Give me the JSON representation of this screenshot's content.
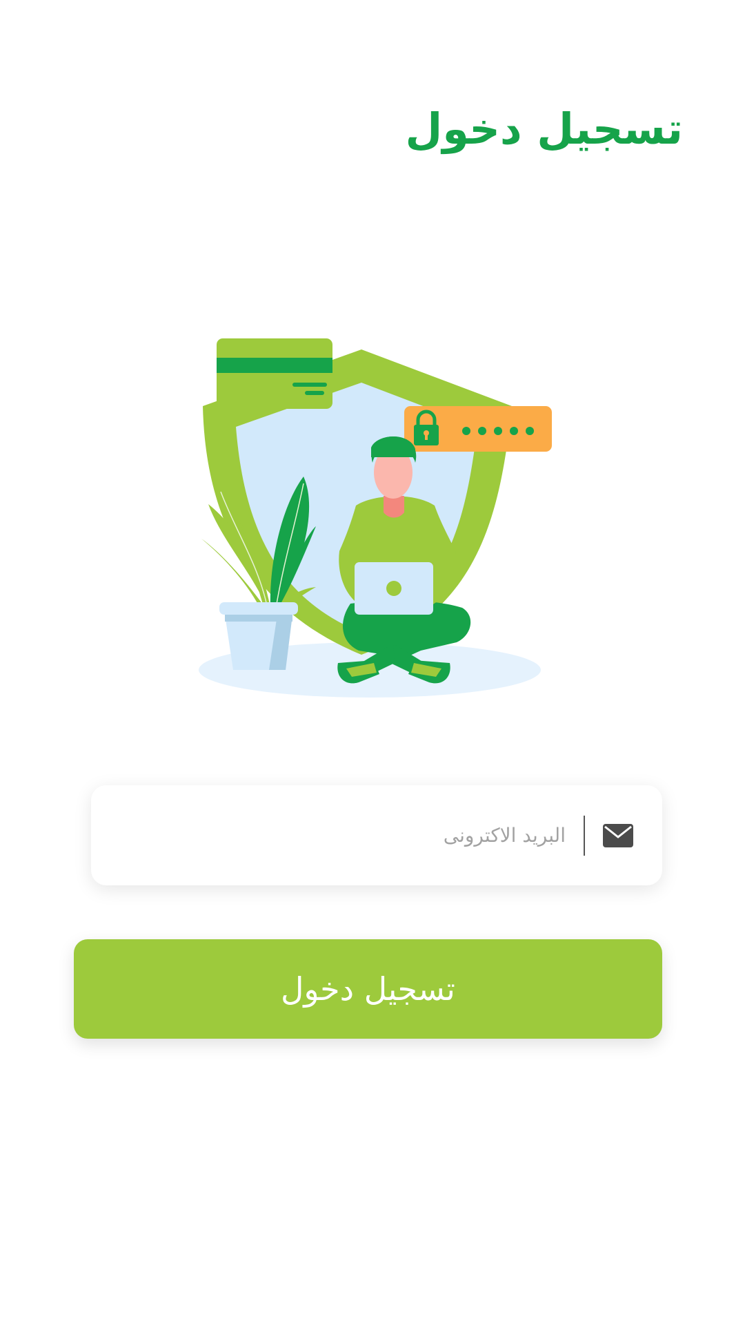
{
  "header": {
    "title": "تسجيل دخول"
  },
  "hero": {
    "password_mask": "•••••"
  },
  "form": {
    "email_placeholder": "البريد الاكترونى",
    "email_value": ""
  },
  "actions": {
    "login_label": "تسجيل دخول"
  },
  "colors": {
    "primary_green": "#16a34a",
    "accent_lime": "#9dca3c",
    "password_orange": "#fbab47",
    "shield_fill": "#d2e9fb"
  },
  "icons": {
    "email": "envelope-icon",
    "lock": "padlock-icon"
  }
}
